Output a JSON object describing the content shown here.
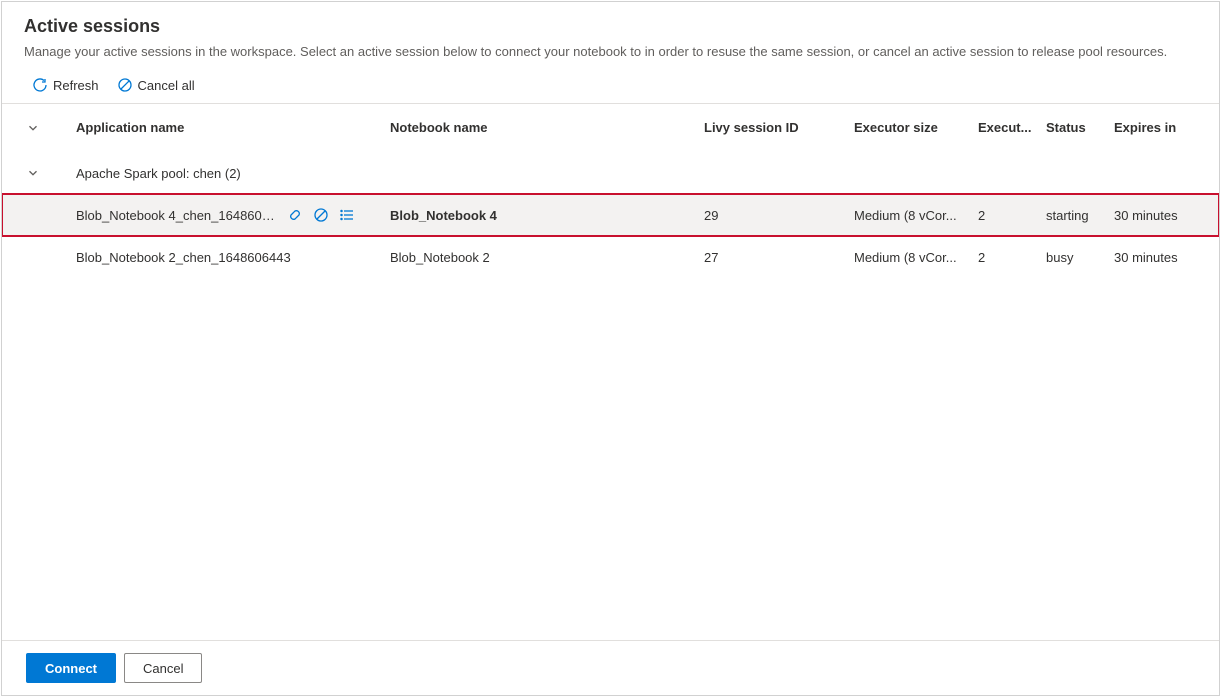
{
  "header": {
    "title": "Active sessions",
    "subtitle": "Manage your active sessions in the workspace. Select an active session below to connect your notebook to in order to resuse the same session, or cancel an active session to release pool resources."
  },
  "toolbar": {
    "refresh": "Refresh",
    "cancel_all": "Cancel all"
  },
  "columns": {
    "app": "Application name",
    "note": "Notebook name",
    "livy": "Livy session ID",
    "exec": "Executor size",
    "execn": "Execut...",
    "status": "Status",
    "expires": "Expires in"
  },
  "group": {
    "label": "Apache Spark pool: chen (2)"
  },
  "rows": [
    {
      "app": "Blob_Notebook 4_chen_16486065...",
      "note": "Blob_Notebook 4",
      "livy": "29",
      "exec": "Medium (8 vCor...",
      "execn": "2",
      "status": "starting",
      "expires": "30 minutes",
      "selected": true
    },
    {
      "app": "Blob_Notebook 2_chen_1648606443",
      "note": "Blob_Notebook 2",
      "livy": "27",
      "exec": "Medium (8 vCor...",
      "execn": "2",
      "status": "busy",
      "expires": "30 minutes",
      "selected": false
    }
  ],
  "footer": {
    "connect": "Connect",
    "cancel": "Cancel"
  }
}
